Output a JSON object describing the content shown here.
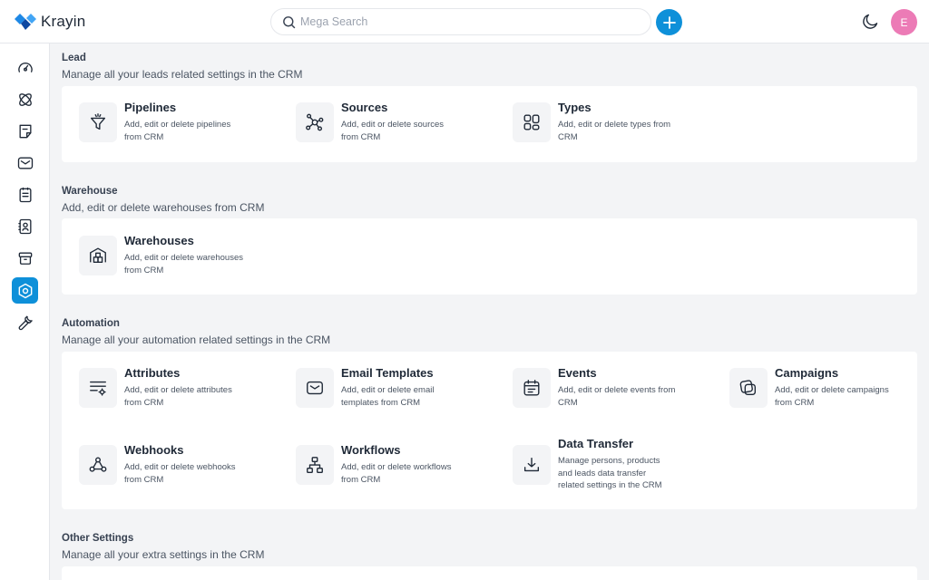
{
  "header": {
    "logo_text": "Krayin",
    "search_placeholder": "Mega Search",
    "avatar_initial": "E"
  },
  "sidebar": {
    "items": [
      {
        "icon": "dashboard-icon",
        "active": false
      },
      {
        "icon": "leads-icon",
        "active": false
      },
      {
        "icon": "quotes-icon",
        "active": false
      },
      {
        "icon": "mail-icon",
        "active": false
      },
      {
        "icon": "activities-icon",
        "active": false
      },
      {
        "icon": "contacts-icon",
        "active": false
      },
      {
        "icon": "products-icon",
        "active": false
      },
      {
        "icon": "settings-icon",
        "active": true
      },
      {
        "icon": "configuration-icon",
        "active": false
      }
    ]
  },
  "sections": {
    "lead": {
      "title": "Lead",
      "description": "Manage all your leads related settings in the CRM",
      "items": [
        {
          "title": "Pipelines",
          "description": "Add, edit or delete pipelines from CRM"
        },
        {
          "title": "Sources",
          "description": "Add, edit or delete sources from CRM"
        },
        {
          "title": "Types",
          "description": "Add, edit or delete types from CRM"
        }
      ]
    },
    "warehouse": {
      "title": "Warehouse",
      "description": "Add, edit or delete warehouses from CRM",
      "items": [
        {
          "title": "Warehouses",
          "description": "Add, edit or delete warehouses from CRM"
        }
      ]
    },
    "automation": {
      "title": "Automation",
      "description": "Manage all your automation related settings in the CRM",
      "items": [
        {
          "title": "Attributes",
          "description": "Add, edit or delete attributes from CRM"
        },
        {
          "title": "Email Templates",
          "description": "Add, edit or delete email templates from CRM"
        },
        {
          "title": "Events",
          "description": "Add, edit or delete events from CRM"
        },
        {
          "title": "Campaigns",
          "description": "Add, edit or delete campaigns from CRM"
        },
        {
          "title": "Webhooks",
          "description": "Add, edit or delete webhooks from CRM"
        },
        {
          "title": "Workflows",
          "description": "Add, edit or delete workflows from CRM"
        },
        {
          "title": "Data Transfer",
          "description": "Manage persons, products and leads data transfer related settings in the CRM"
        }
      ]
    },
    "other": {
      "title": "Other Settings",
      "description": "Manage all your extra settings in the CRM"
    }
  },
  "colors": {
    "accent": "#0e90d9",
    "avatar": "#ec7bb6",
    "background": "#f3f4f6"
  }
}
